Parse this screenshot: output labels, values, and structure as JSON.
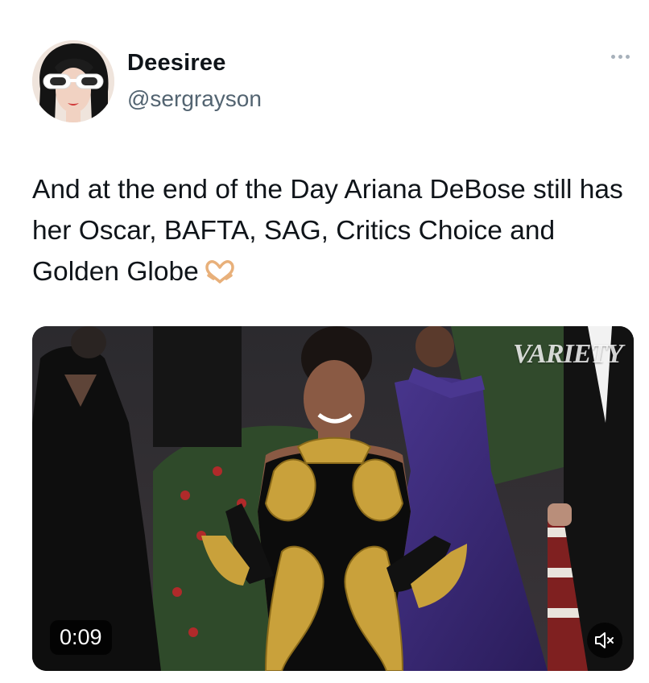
{
  "user": {
    "display_name": "Deesiree",
    "handle": "@sergrayson",
    "avatar_icon": "avatar-woman-white-sunglasses"
  },
  "more_menu_icon": "more-horizontal-icon",
  "tweet": {
    "text": "And at the end of the Day Ariana DeBose still has her Oscar, BAFTA, SAG, Critics Choice and Golden Globe",
    "emoji_icon": "heart-hands-emoji"
  },
  "media": {
    "type": "video",
    "watermark": "VARIETY",
    "duration": "0:09",
    "mute_icon": "speaker-muted-icon"
  },
  "colors": {
    "text_primary": "#0f1419",
    "text_secondary": "#536471",
    "gold": "#c9a13b",
    "purple_gown": "#3e2a7a"
  }
}
